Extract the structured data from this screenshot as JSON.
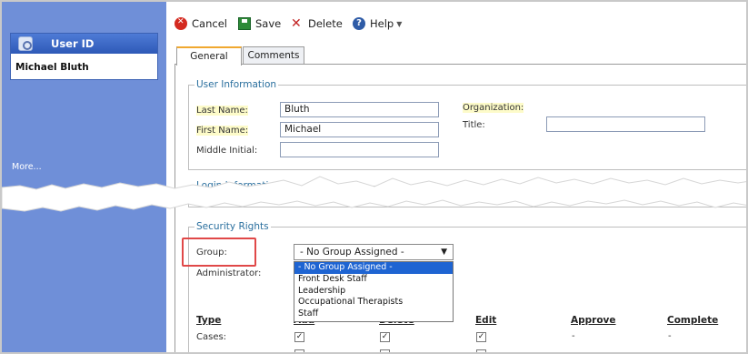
{
  "sidebar": {
    "card_title": "User ID",
    "user_name": "Michael Bluth",
    "more_label": "More..."
  },
  "toolbar": {
    "cancel_label": "Cancel",
    "save_label": "Save",
    "delete_label": "Delete",
    "help_label": "Help"
  },
  "tabs": [
    {
      "label": "General",
      "active": true
    },
    {
      "label": "Comments",
      "active": false
    }
  ],
  "user_info": {
    "legend": "User Information",
    "last_name_label": "Last Name:",
    "last_name_value": "Bluth",
    "first_name_label": "First Name:",
    "first_name_value": "Michael",
    "middle_initial_label": "Middle Initial:",
    "middle_initial_value": "",
    "organization_label": "Organization:",
    "title_label": "Title:",
    "title_value": ""
  },
  "login_info": {
    "legend": "Login Information"
  },
  "security": {
    "legend": "Security Rights",
    "group_label": "Group:",
    "group_selected": "- No Group Assigned -",
    "administrator_label": "Administrator:",
    "group_options": [
      "- No Group Assigned -",
      "Front Desk Staff",
      "Leadership",
      "Occupational Therapists",
      "Staff"
    ],
    "columns": [
      "Type",
      "Add",
      "Delete",
      "Edit",
      "Approve",
      "Complete"
    ],
    "rows": [
      {
        "type": "Cases:",
        "add": true,
        "delete": true,
        "edit": true,
        "approve": "-",
        "complete": "-"
      }
    ]
  },
  "colors": {
    "sidebar_bg": "#6f8fd8",
    "card_header": "#2e59b7",
    "legend_text": "#2a6f9e",
    "highlight_box": "#e04848",
    "selected_option": "#1e64d2",
    "tab_active_accent": "#f0a830"
  }
}
